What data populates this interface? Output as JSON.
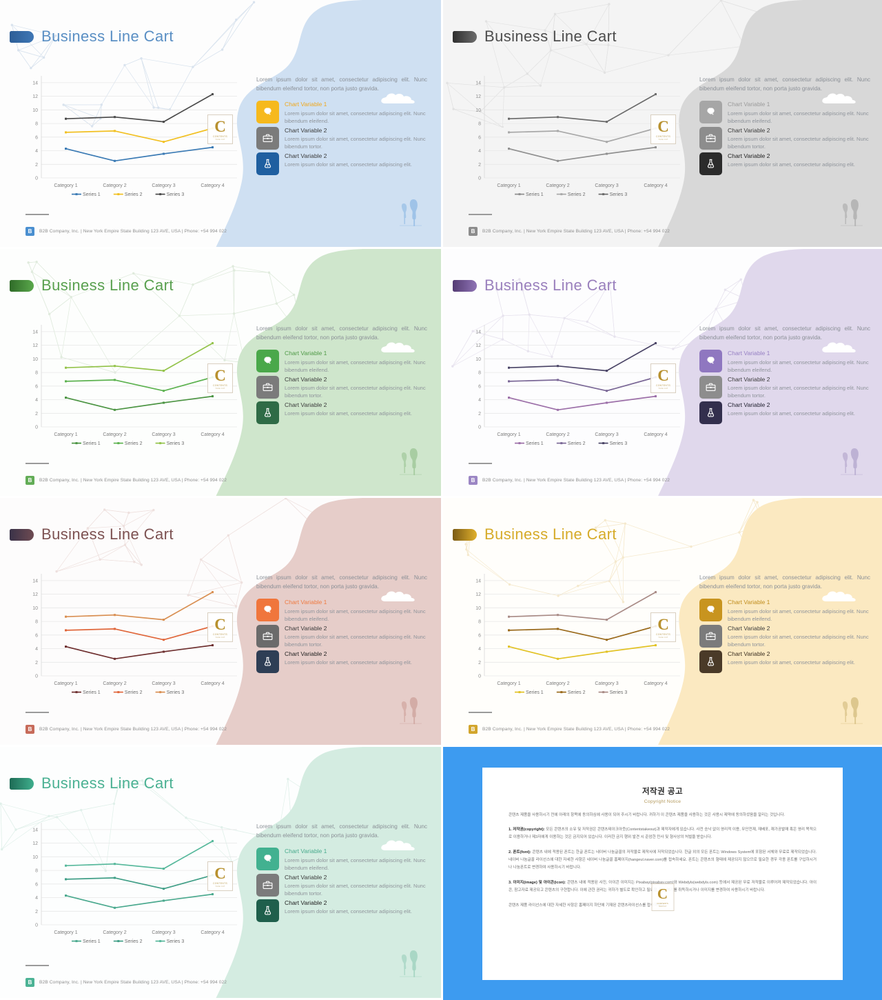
{
  "deck": {
    "title": "Business Line Cart",
    "footer_text": "B2B Company, Inc. | New York Empire State Building 123 AVE, USA | Phone: +54 994 022",
    "footer_logo": "B",
    "watermark": {
      "letter": "C",
      "line2": "CONTENTS",
      "line3": "TAKE OUT"
    }
  },
  "lead_paragraph": "Lorem ipsum dolor sit amet, consectetur adipiscing elit. Nunc bibendum eleifend tortor, non porta justo gravida.",
  "features": [
    {
      "icon": "gear-icon",
      "title": "Chart Variable 1",
      "desc": "Lorem ipsum dolor sit amet, consectetur adipiscing elit. Nunc bibendum eleifend."
    },
    {
      "icon": "briefcase-icon",
      "title": "Chart Variable 2",
      "desc": "Lorem ipsum dolor sit amet, consectetur adipiscing elit. Nunc bibendum tortor."
    },
    {
      "icon": "flask-icon",
      "title": "Chart Variable 2",
      "desc": "Lorem ipsum dolor sit amet, consectetur adipiscing elit."
    }
  ],
  "chart_data": {
    "type": "line",
    "title": "Business Line Cart",
    "xlabel": "",
    "ylabel": "",
    "categories": [
      "Category 1",
      "Category 2",
      "Category 3",
      "Category 4"
    ],
    "series": [
      {
        "name": "Series 1",
        "values": [
          4.3,
          2.5,
          3.55,
          4.5
        ]
      },
      {
        "name": "Series 2",
        "values": [
          6.7,
          6.9,
          5.3,
          7.3
        ]
      },
      {
        "name": "Series 3",
        "values": [
          8.7,
          8.95,
          8.25,
          12.3
        ]
      }
    ],
    "ylim": [
      0,
      15
    ],
    "yticks": [
      0,
      2,
      4,
      6,
      8,
      10,
      12,
      14
    ],
    "grid": true,
    "legend_position": "bottom",
    "markers": true
  },
  "themes": [
    {
      "key": "blue",
      "accent": "#3f77b5",
      "title_color": "#5a8fc4",
      "chip": [
        "#3f77b5",
        "#2d5e97"
      ],
      "panel": "#cfe0f2",
      "slide_bg": "#fdfdfd",
      "series_colors": [
        "#3a7ab4",
        "#f2c021",
        "#4a4a4a"
      ],
      "icon_bg": [
        "#f6b91d",
        "#7b7b7b",
        "#1f5fa0"
      ],
      "feature_title_colors": [
        "#f0a81c",
        "#3b3b3b",
        "#3b3b3b"
      ],
      "net": "#d3dfec",
      "cloud": "#ffffff",
      "tree": "#9fc3e8",
      "footer_logo_bg": "#4a8fd0"
    },
    {
      "key": "gray",
      "accent": "#4a4a4a",
      "title_color": "#4d4d4d",
      "chip": [
        "#6d6d6d",
        "#2e2e2e"
      ],
      "panel": "#d8d8d8",
      "slide_bg": "#f4f4f4",
      "series_colors": [
        "#8f8f8f",
        "#a8a8a8",
        "#6a6a6a"
      ],
      "icon_bg": [
        "#a6a6a6",
        "#8d8d8d",
        "#2b2b2b"
      ],
      "feature_title_colors": [
        "#9b9b9b",
        "#3b3b3b",
        "#1f1f1f"
      ],
      "net": "#e0e0e0",
      "cloud": "#ffffff",
      "tree": "#b6b6b6",
      "footer_logo_bg": "#8c8c8c"
    },
    {
      "key": "green",
      "accent": "#4a9a43",
      "title_color": "#59a04f",
      "chip": [
        "#5aa84c",
        "#2f6b28"
      ],
      "panel": "#cfe6cc",
      "slide_bg": "#fdfefd",
      "series_colors": [
        "#4b9442",
        "#5cb24f",
        "#93c34a"
      ],
      "icon_bg": [
        "#4aa84a",
        "#7b7b7b",
        "#2f6b46"
      ],
      "feature_title_colors": [
        "#4f9a47",
        "#3b3b3b",
        "#3b3b3b"
      ],
      "net": "#dbe8d8",
      "cloud": "#ffffff",
      "tree": "#a8cda2",
      "footer_logo_bg": "#63ad57"
    },
    {
      "key": "purple",
      "accent": "#8b6fae",
      "title_color": "#9a80bd",
      "chip": [
        "#8f74b5",
        "#543b73"
      ],
      "panel": "#e0d8ec",
      "slide_bg": "#fdfdfe",
      "series_colors": [
        "#9c6fa8",
        "#7a6796",
        "#4a4466"
      ],
      "icon_bg": [
        "#8f77c0",
        "#8d8d8d",
        "#332f4d"
      ],
      "feature_title_colors": [
        "#9781c4",
        "#3b3b3b",
        "#1f1f2e"
      ],
      "net": "#e4dfec",
      "cloud": "#ffffff",
      "tree": "#bdb2d4",
      "footer_logo_bg": "#9b86c4"
    },
    {
      "key": "red",
      "accent": "#8c4a4a",
      "title_color": "#7d5252",
      "chip": [
        "#6e4b52",
        "#3a3248"
      ],
      "panel": "#e6cdc9",
      "slide_bg": "#fdfcfc",
      "series_colors": [
        "#6e2f2f",
        "#e0663a",
        "#d98f52"
      ],
      "icon_bg": [
        "#f0763c",
        "#6b6b6b",
        "#2e3e55"
      ],
      "feature_title_colors": [
        "#ef7b42",
        "#3b3b3b",
        "#1f1f1f"
      ],
      "net": "#ecdcd9",
      "cloud": "#ffffff",
      "tree": "#d3aca6",
      "footer_logo_bg": "#c76b5a"
    },
    {
      "key": "yellow",
      "accent": "#c9a227",
      "title_color": "#d6ab2a",
      "chip": [
        "#e0b02c",
        "#7a5a14"
      ],
      "panel": "#fbe9c1",
      "slide_bg": "#fffefb",
      "series_colors": [
        "#e2c224",
        "#9a6a1c",
        "#a98b86"
      ],
      "icon_bg": [
        "#c8941f",
        "#7b7b7b",
        "#4a3a28"
      ],
      "feature_title_colors": [
        "#c08d1d",
        "#3b3b3b",
        "#3b2f20"
      ],
      "net": "#f4e6c6",
      "cloud": "#ffffff",
      "tree": "#ddc78e",
      "footer_logo_bg": "#d2a52c"
    },
    {
      "key": "teal",
      "accent": "#3fa98a",
      "title_color": "#4bb193",
      "chip": [
        "#3fae8d",
        "#1e6b55"
      ],
      "panel": "#d4ece1",
      "slide_bg": "#fdfefe",
      "series_colors": [
        "#4aa98e",
        "#3f9e86",
        "#56b89b"
      ],
      "icon_bg": [
        "#42b190",
        "#7b7b7b",
        "#1f5f4c"
      ],
      "feature_title_colors": [
        "#48ab8d",
        "#3b3b3b",
        "#1f1f1f"
      ],
      "net": "#dceee7",
      "cloud": "#ffffff",
      "tree": "#a9d7c5",
      "footer_logo_bg": "#4cb395"
    }
  ],
  "copyright": {
    "heading_ko": "저작권 공고",
    "heading_en": "Copyright Notice",
    "border_color": "#3d9bf0",
    "paragraphs": [
      {
        "bold": "",
        "text": "콘텐츠 제품을 사용하시기 전에 아래의 항목에 동의하심에 사용이 되어 주시기 바랍니다. 귀하가 이 콘텐츠 제품을 사용하는 것은 사용시 제약에 동의하셨음을 알리는 것입니다."
      },
      {
        "bold": "1. 저작권(copyright):",
        "text": " 모든 콘텐츠의 소유 및 저작권은 콘텐츠테이크아웃(Contentstakeout)과 제작자에게 있습니다. 사전 승낙 없이 영리적 이용, 무단전재, 재배포, 재가공발매 혹은 영리 목적으로 이용하거나 제3자에게 이용하는 것은 금지되어 있습니다. 이러한 금지 행위 발견 시 준엄한 민사 및 형사상의 처벌을 받습니다."
      },
      {
        "bold": "2. 폰트(font):",
        "text": " 콘텐츠 내에 적용된 폰트는 한글 폰트는 네이버 나눔글꼴의 저작물로 제작사에 저작되었습니다. 한글 외의 모든 폰트는 Windows System에 포함된 서체와 무료로 제작되었습니다. 네이버 나눔글꼴 라이선스에 대한 자세한 사항은 네이버 나눔글꼴 홈페이지(hangeul.naver.com)를 접속하세요. 폰트는 콘텐츠의 형태에 제공되지 않으므로 필요한 경우 각종 폰트를 구입하시거나 나눔폰트로 변경하여 사용하시기 바랍니다."
      },
      {
        "bold": "3. 이미지(image) 및 아이콘(icon):",
        "text": " 콘텐츠 내에 적용된 사진, 아이콘 이미지는 Pixabay(pixabay.com)와 Webdyls(webdyls.com) 등에서 제공된 무료 저작물로 이루어져 제작되었습니다. 아이콘, 참고자료 제공되고 콘텐츠의 구현합니다. 이에 관한 권리는 귀하가 별도로 확인하고 필요할 경우 여기를 취득하시거나 이미지를 변경하여 사용하시기 바랍니다."
      },
      {
        "bold": "",
        "text": "콘텐츠 제품 라이선스에 대한 자세한 사항은 홈페이지 하단에 기재된 콘텐츠라이선스를 접속하세요."
      }
    ]
  }
}
